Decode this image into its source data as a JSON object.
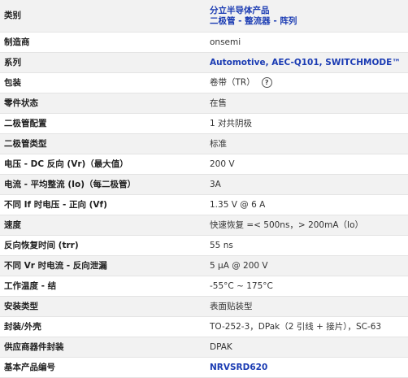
{
  "specs": {
    "category": {
      "label": "类别",
      "link1": "分立半导体产品",
      "link2": "二极管 - 整流器 - 阵列"
    },
    "rows": [
      {
        "label": "制造商",
        "value": "onsemi"
      },
      {
        "label": "系列",
        "value": "Automotive, AEC-Q101, SWITCHMODE™"
      },
      {
        "label": "包装",
        "value": "卷带（TR）"
      },
      {
        "label": "零件状态",
        "value": "在售"
      },
      {
        "label": "二极管配置",
        "value": "1 对共阴极"
      },
      {
        "label": "二极管类型",
        "value": "标准"
      },
      {
        "label": "电压 - DC 反向 (Vr)（最大值）",
        "value": "200 V"
      },
      {
        "label": "电流 - 平均整流 (Io)（每二极管）",
        "value": "3A"
      },
      {
        "label": "不同 If 时电压 - 正向 (Vf)",
        "value": "1.35 V @ 6 A"
      },
      {
        "label": "速度",
        "value": "快速恢复 =< 500ns，> 200mA（Io）"
      },
      {
        "label": "反向恢复时间 (trr)",
        "value": "55 ns"
      },
      {
        "label": "不同 Vr 时电流 - 反向泄漏",
        "value": "5 µA @ 200 V"
      },
      {
        "label": "工作温度 - 结",
        "value": "-55°C ~ 175°C"
      },
      {
        "label": "安装类型",
        "value": "表面贴装型"
      },
      {
        "label": "封装/外壳",
        "value": "TO-252-3，DPak（2 引线 + 接片），SC-63"
      },
      {
        "label": "供应商器件封装",
        "value": "DPAK"
      },
      {
        "label": "基本产品编号",
        "value": "NRVSRD620"
      }
    ],
    "help_icon_glyph": "?"
  }
}
